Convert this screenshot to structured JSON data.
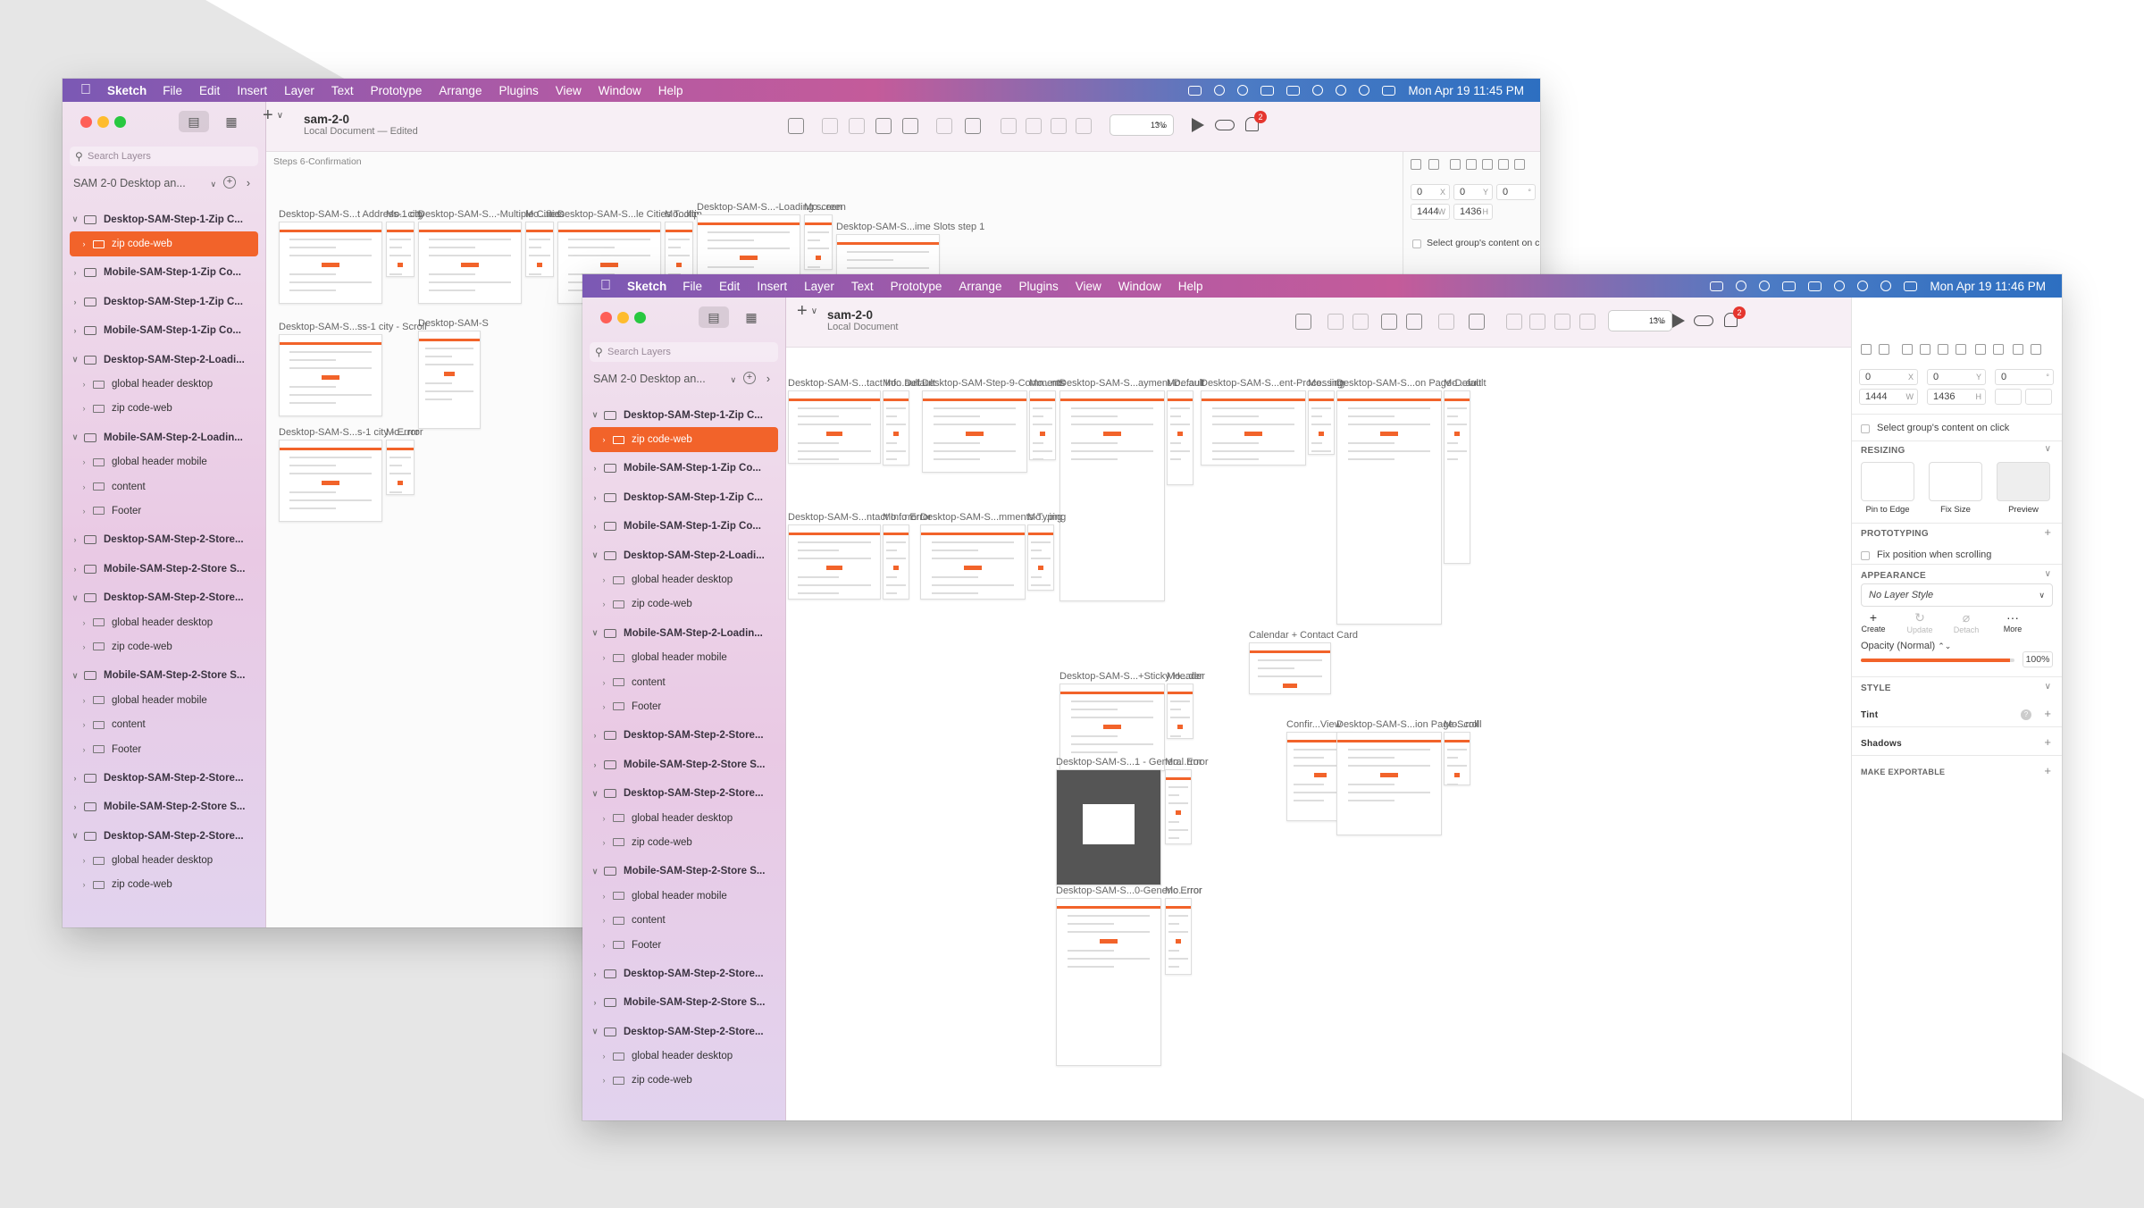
{
  "menubar": {
    "app": "Sketch",
    "items": [
      "File",
      "Edit",
      "Insert",
      "Layer",
      "Text",
      "Prototype",
      "Arrange",
      "Plugins",
      "View",
      "Window",
      "Help"
    ]
  },
  "back_window": {
    "clock": "Mon Apr 19  11:45 PM",
    "doc_title": "sam-2-0",
    "doc_subtitle": "Local Document — Edited",
    "search_placeholder": "Search Layers",
    "page_name": "SAM 2-0 Desktop an...",
    "zoom": "13%",
    "notifications": "2",
    "breadcrumb": "Steps 6-Confirmation",
    "inspector": {
      "x": "0",
      "y": "0",
      "rot": "0",
      "w": "1444",
      "h": "1436",
      "select_label": "Select group's content on click"
    },
    "layers": [
      {
        "label": "Desktop-SAM-Step-1-Zip C...",
        "type": "artboard",
        "chev": "v"
      },
      {
        "label": "zip code-web",
        "type": "group",
        "chev": ">",
        "selected": true
      },
      {
        "label": "Mobile-SAM-Step-1-Zip Co...",
        "type": "artboard",
        "chev": ">"
      },
      {
        "label": "Desktop-SAM-Step-1-Zip C...",
        "type": "artboard",
        "chev": ">"
      },
      {
        "label": "Mobile-SAM-Step-1-Zip Co...",
        "type": "artboard",
        "chev": ">"
      },
      {
        "label": "Desktop-SAM-Step-2-Loadi...",
        "type": "artboard",
        "chev": "v"
      },
      {
        "label": "global header desktop",
        "type": "group",
        "chev": ">"
      },
      {
        "label": "zip code-web",
        "type": "group",
        "chev": ">"
      },
      {
        "label": "Mobile-SAM-Step-2-Loadin...",
        "type": "artboard",
        "chev": "v"
      },
      {
        "label": "global header mobile",
        "type": "group",
        "chev": ">"
      },
      {
        "label": "content",
        "type": "group",
        "chev": ">"
      },
      {
        "label": "Footer",
        "type": "group",
        "chev": ">"
      },
      {
        "label": "Desktop-SAM-Step-2-Store...",
        "type": "artboard",
        "chev": ">"
      },
      {
        "label": "Mobile-SAM-Step-2-Store S...",
        "type": "artboard",
        "chev": ">"
      },
      {
        "label": "Desktop-SAM-Step-2-Store...",
        "type": "artboard",
        "chev": "v"
      },
      {
        "label": "global header desktop",
        "type": "group",
        "chev": ">"
      },
      {
        "label": "zip code-web",
        "type": "group",
        "chev": ">"
      },
      {
        "label": "Mobile-SAM-Step-2-Store S...",
        "type": "artboard",
        "chev": "v"
      },
      {
        "label": "global header mobile",
        "type": "group",
        "chev": ">"
      },
      {
        "label": "content",
        "type": "group",
        "chev": ">"
      },
      {
        "label": "Footer",
        "type": "group",
        "chev": ">"
      },
      {
        "label": "Desktop-SAM-Step-2-Store...",
        "type": "artboard",
        "chev": ">"
      },
      {
        "label": "Mobile-SAM-Step-2-Store S...",
        "type": "artboard",
        "chev": ">"
      },
      {
        "label": "Desktop-SAM-Step-2-Store...",
        "type": "artboard",
        "chev": "v"
      },
      {
        "label": "global header desktop",
        "type": "group",
        "chev": ">"
      },
      {
        "label": "zip code-web",
        "type": "group",
        "chev": ">"
      }
    ],
    "artboards": [
      "Desktop-SAM-S...t Address-1 city",
      "Mo...city",
      "Desktop-SAM-S...-Multiple Cities",
      "Mo...ities",
      "Desktop-SAM-S...le Cities Tooltip",
      "Mo...ltip",
      "Desktop-SAM-S...-Loading screen",
      "Mo...een",
      "Desktop-SAM-S...ime Slots step 1",
      "Desktop-SAM-S...ss-1 city - Scroll",
      "Desktop-SAM-S",
      "Desktop-SAM-S...s-1 city - Error",
      "Mo...rror"
    ]
  },
  "front_window": {
    "clock": "Mon Apr 19  11:46 PM",
    "doc_title": "sam-2-0",
    "doc_subtitle": "Local Document",
    "search_placeholder": "Search Layers",
    "page_name": "SAM 2-0 Desktop an...",
    "zoom": "13%",
    "notifications": "2",
    "inspector": {
      "x": "0",
      "y": "0",
      "rot": "0",
      "w": "1444",
      "h": "1436",
      "select_label": "Select group's content on click",
      "resizing": "RESIZING",
      "pin": "Pin to Edge",
      "fix": "Fix Size",
      "preview": "Preview",
      "prototyping": "PROTOTYPING",
      "fix_scroll": "Fix position when scrolling",
      "appearance": "APPEARANCE",
      "layer_style": "No Layer Style",
      "create": "Create",
      "update": "Update",
      "detach": "Detach",
      "more": "More",
      "opacity_label": "Opacity (Normal)",
      "opacity": "100%",
      "style": "STYLE",
      "tint": "Tint",
      "shadows": "Shadows",
      "export": "MAKE EXPORTABLE"
    },
    "layers": [
      {
        "label": "Desktop-SAM-Step-1-Zip C...",
        "type": "artboard",
        "chev": "v"
      },
      {
        "label": "zip code-web",
        "type": "group",
        "chev": ">",
        "selected": true
      },
      {
        "label": "Mobile-SAM-Step-1-Zip Co...",
        "type": "artboard",
        "chev": ">"
      },
      {
        "label": "Desktop-SAM-Step-1-Zip C...",
        "type": "artboard",
        "chev": ">"
      },
      {
        "label": "Mobile-SAM-Step-1-Zip Co...",
        "type": "artboard",
        "chev": ">"
      },
      {
        "label": "Desktop-SAM-Step-2-Loadi...",
        "type": "artboard",
        "chev": "v"
      },
      {
        "label": "global header desktop",
        "type": "group",
        "chev": ">"
      },
      {
        "label": "zip code-web",
        "type": "group",
        "chev": ">"
      },
      {
        "label": "Mobile-SAM-Step-2-Loadin...",
        "type": "artboard",
        "chev": "v"
      },
      {
        "label": "global header mobile",
        "type": "group",
        "chev": ">"
      },
      {
        "label": "content",
        "type": "group",
        "chev": ">"
      },
      {
        "label": "Footer",
        "type": "group",
        "chev": ">"
      },
      {
        "label": "Desktop-SAM-Step-2-Store...",
        "type": "artboard",
        "chev": ">"
      },
      {
        "label": "Mobile-SAM-Step-2-Store S...",
        "type": "artboard",
        "chev": ">"
      },
      {
        "label": "Desktop-SAM-Step-2-Store...",
        "type": "artboard",
        "chev": "v"
      },
      {
        "label": "global header desktop",
        "type": "group",
        "chev": ">"
      },
      {
        "label": "zip code-web",
        "type": "group",
        "chev": ">"
      },
      {
        "label": "Mobile-SAM-Step-2-Store S...",
        "type": "artboard",
        "chev": "v"
      },
      {
        "label": "global header mobile",
        "type": "group",
        "chev": ">"
      },
      {
        "label": "content",
        "type": "group",
        "chev": ">"
      },
      {
        "label": "Footer",
        "type": "group",
        "chev": ">"
      },
      {
        "label": "Desktop-SAM-Step-2-Store...",
        "type": "artboard",
        "chev": ">"
      },
      {
        "label": "Mobile-SAM-Step-2-Store S...",
        "type": "artboard",
        "chev": ">"
      },
      {
        "label": "Desktop-SAM-Step-2-Store...",
        "type": "artboard",
        "chev": "v"
      },
      {
        "label": "global header desktop",
        "type": "group",
        "chev": ">"
      },
      {
        "label": "zip code-web",
        "type": "group",
        "chev": ">"
      }
    ],
    "artboards": [
      "Desktop-SAM-S...tact Info Default",
      "Mo...ault",
      "Desktop-SAM-Step-9-Comments",
      "Mo...nts",
      "Desktop-SAM-S...ayment-Default",
      "Mo...ault",
      "Desktop-SAM-S...ent-Processing",
      "Mo...ing",
      "Desktop-SAM-S...on Page-Default",
      "Mo...ault",
      "Desktop-SAM-S...ntact Info Error",
      "Mo...rror",
      "Desktop-SAM-S...mments-Typing",
      "Mo...ing",
      "Calendar + Contact Card",
      "Desktop-SAM-S...+Sticky Header",
      "Mo...der",
      "Confir...View",
      "Desktop-SAM-S...ion Page-Scroll",
      "Mo...roll",
      "Desktop-SAM-S...1 - General Error",
      "Mo...rror",
      "Desktop-SAM-S...0-Generic Error",
      "Mo...rror"
    ]
  },
  "colors": {
    "accent": "#f2632a",
    "badge": "#e5362f"
  }
}
